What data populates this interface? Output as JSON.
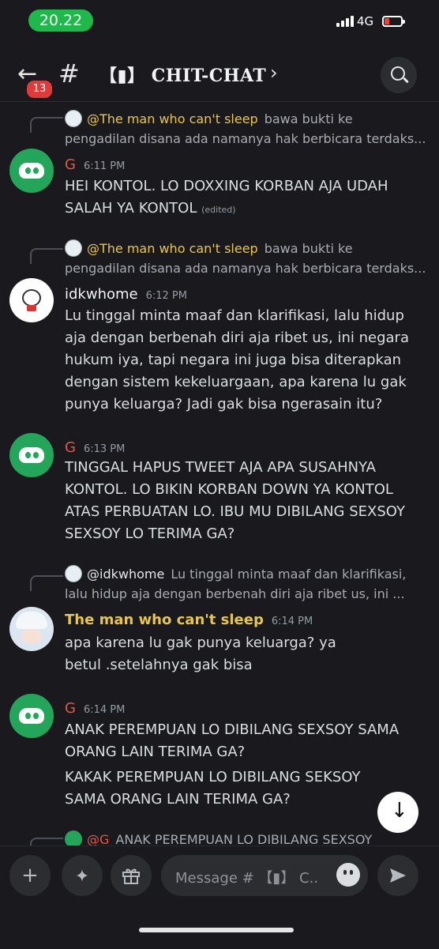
{
  "status_bar": {
    "time": "20.22",
    "network": "4G"
  },
  "header": {
    "back_icon": "arrow-left-icon",
    "unread_badge": "13",
    "channel_hash": "#",
    "channel_name": "【▮】 CHIT-CHAT",
    "chevron": "›",
    "search_icon": "search-icon"
  },
  "messages": [
    {
      "reply": {
        "name": "@The man who can't sleep",
        "text": "bawa bukti ke",
        "cont": "pengadilan disana ada namanya hak berbicara terdaks..."
      },
      "author": "G",
      "time": "6:11 PM",
      "lines": [
        "HEI KONTOL. LO DOXXING KORBAN AJA UDAH",
        "SALAH YA KONTOL"
      ],
      "edited": "(edited)"
    },
    {
      "reply": {
        "name": "@The man who can't sleep",
        "text": "bawa bukti ke",
        "cont": "pengadilan disana ada namanya hak berbicara terdaks..."
      },
      "author": "idkwhome",
      "time": "6:12 PM",
      "lines": [
        "Lu tinggal minta maaf dan klarifikasi, lalu hidup",
        "aja dengan berbenah diri aja ribet us, ini negara",
        "hukum iya, tapi negara ini juga bisa diterapkan",
        "dengan sistem kekeluargaan, apa karena lu gak",
        "punya keluarga? Jadi gak bisa ngerasain itu?"
      ]
    },
    {
      "author": "G",
      "time": "6:13 PM",
      "lines": [
        "TINGGAL HAPUS TWEET AJA APA SUSAHNYA",
        "KONTOL. LO BIKIN KORBAN DOWN YA KONTOL",
        "ATAS PERBUATAN LO. IBU MU DIBILANG SEXSOY",
        "SEXSOY LO TERIMA GA?"
      ]
    },
    {
      "reply": {
        "name": "@idkwhome",
        "text": "Lu tinggal minta maaf dan klarifikasi,",
        "cont": "lalu hidup aja dengan berbenah diri aja ribet us, ini ..."
      },
      "author": "The man who can't sleep",
      "time": "6:14 PM",
      "lines": [
        "apa karena lu gak punya keluarga? ya",
        "betul .setelahnya gak bisa"
      ]
    },
    {
      "author": "G",
      "time": "6:14 PM",
      "lines": [
        "ANAK PEREMPUAN LO DIBILANG SEXSOY SAMA",
        "ORANG LAIN TERIMA GA?",
        "KAKAK PEREMPUAN LO DIBILANG SEKSOY",
        "SAMA ORANG LAIN TERIMA GA?"
      ]
    }
  ],
  "partial_reply": {
    "name": "@G",
    "text": "ANAK PEREMPUAN LO DIBILANG SEXSOY"
  },
  "composer": {
    "add_label": "+",
    "placeholder": "Message # 【▮】 C..",
    "emoji_icon": "emoji-icon",
    "send_icon": "send-icon"
  }
}
